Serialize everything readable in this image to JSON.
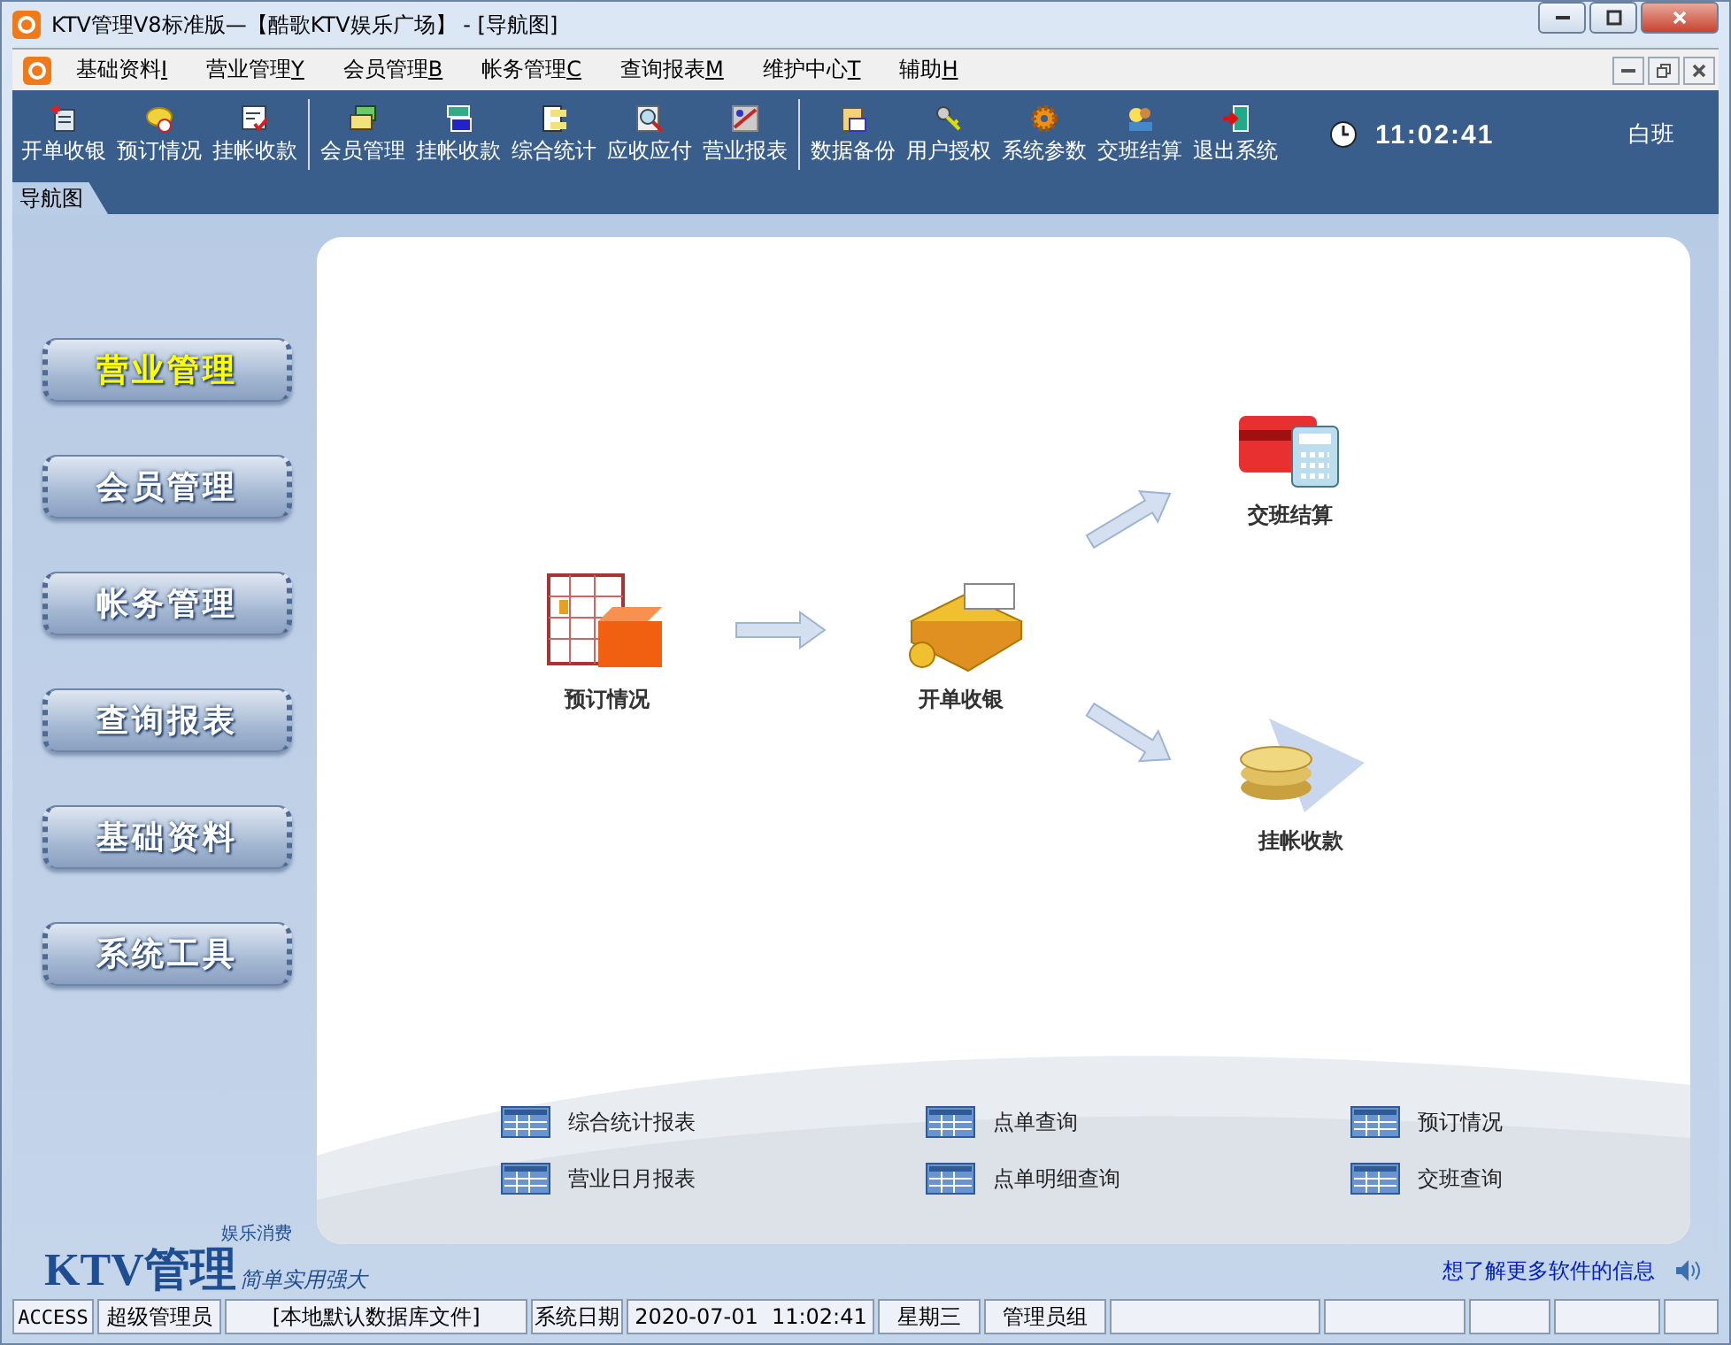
{
  "window": {
    "title": "KTV管理V8标准版—【酷歌KTV娱乐广场】 - [导航图]"
  },
  "menu": [
    {
      "label": "基础资料",
      "key": "I"
    },
    {
      "label": "营业管理",
      "key": "Y"
    },
    {
      "label": "会员管理",
      "key": "B"
    },
    {
      "label": "帐务管理",
      "key": "C"
    },
    {
      "label": "查询报表",
      "key": "M"
    },
    {
      "label": "维护中心",
      "key": "T"
    },
    {
      "label": "辅助",
      "key": "H"
    }
  ],
  "toolbar": [
    [
      {
        "label": "开单收银"
      },
      {
        "label": "预订情况"
      },
      {
        "label": "挂帐收款"
      }
    ],
    [
      {
        "label": "会员管理"
      },
      {
        "label": "挂帐收款"
      },
      {
        "label": "综合统计"
      },
      {
        "label": "应收应付"
      },
      {
        "label": "营业报表"
      }
    ],
    [
      {
        "label": "数据备份"
      },
      {
        "label": "用户授权"
      },
      {
        "label": "系统参数"
      },
      {
        "label": "交班结算"
      },
      {
        "label": "退出系统"
      }
    ]
  ],
  "clock": "11:02:41",
  "shift": "白班",
  "tabs": [
    {
      "label": "导航图",
      "selected": true
    }
  ],
  "side_nav": [
    {
      "label": "营业管理",
      "selected": true
    },
    {
      "label": "会员管理",
      "selected": false
    },
    {
      "label": "帐务管理",
      "selected": false
    },
    {
      "label": "查询报表",
      "selected": false
    },
    {
      "label": "基础资料",
      "selected": false
    },
    {
      "label": "系统工具",
      "selected": false
    }
  ],
  "flow": [
    {
      "label": "预订情况"
    },
    {
      "label": "开单收银"
    },
    {
      "label": "交班结算"
    },
    {
      "label": "挂帐收款"
    }
  ],
  "quick_links": [
    "综合统计报表",
    "点单查询",
    "预订情况",
    "营业日月报表",
    "点单明细查询",
    "交班查询"
  ],
  "logo": {
    "tagline_top": "娱乐消费",
    "name": "KTV管理",
    "tagline": "简单实用强大"
  },
  "info_link": "想了解更多软件的信息",
  "status_bar": [
    "ACCESS",
    "超级管理员",
    "[本地默认数据库文件]",
    "系统日期",
    "2020-07-01  11:02:41",
    "星期三",
    "管理员组"
  ]
}
